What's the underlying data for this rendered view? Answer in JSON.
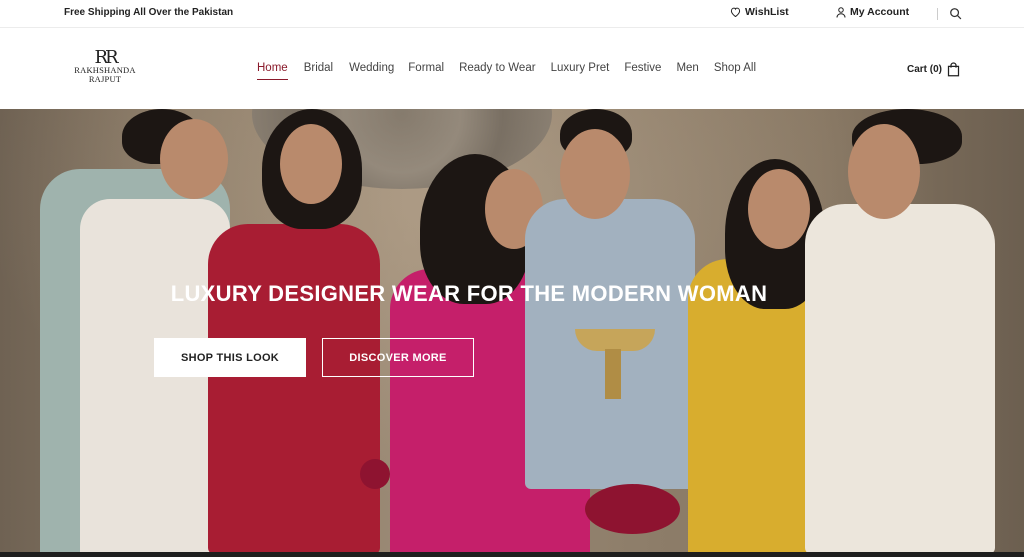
{
  "topbar": {
    "shipping_text": "Free Shipping All Over the Pakistan",
    "wishlist_label": "WishList",
    "account_label": "My Account"
  },
  "brand": {
    "monogram": "RR",
    "line1": "RAKHSHANDA",
    "line2": "RAJPUT"
  },
  "nav": {
    "items": [
      {
        "label": "Home",
        "active": true
      },
      {
        "label": "Bridal"
      },
      {
        "label": "Wedding"
      },
      {
        "label": "Formal"
      },
      {
        "label": "Ready to Wear"
      },
      {
        "label": "Luxury Pret"
      },
      {
        "label": "Festive"
      },
      {
        "label": "Men"
      },
      {
        "label": "Shop All"
      }
    ]
  },
  "cart": {
    "label": "Cart (0)"
  },
  "hero": {
    "title": "LUXURY DESIGNER WEAR FOR THE MODERN WOMAN",
    "primary_button": "SHOP THIS LOOK",
    "secondary_button": "DISCOVER MORE"
  },
  "colors": {
    "accent": "#8a1a2b"
  }
}
